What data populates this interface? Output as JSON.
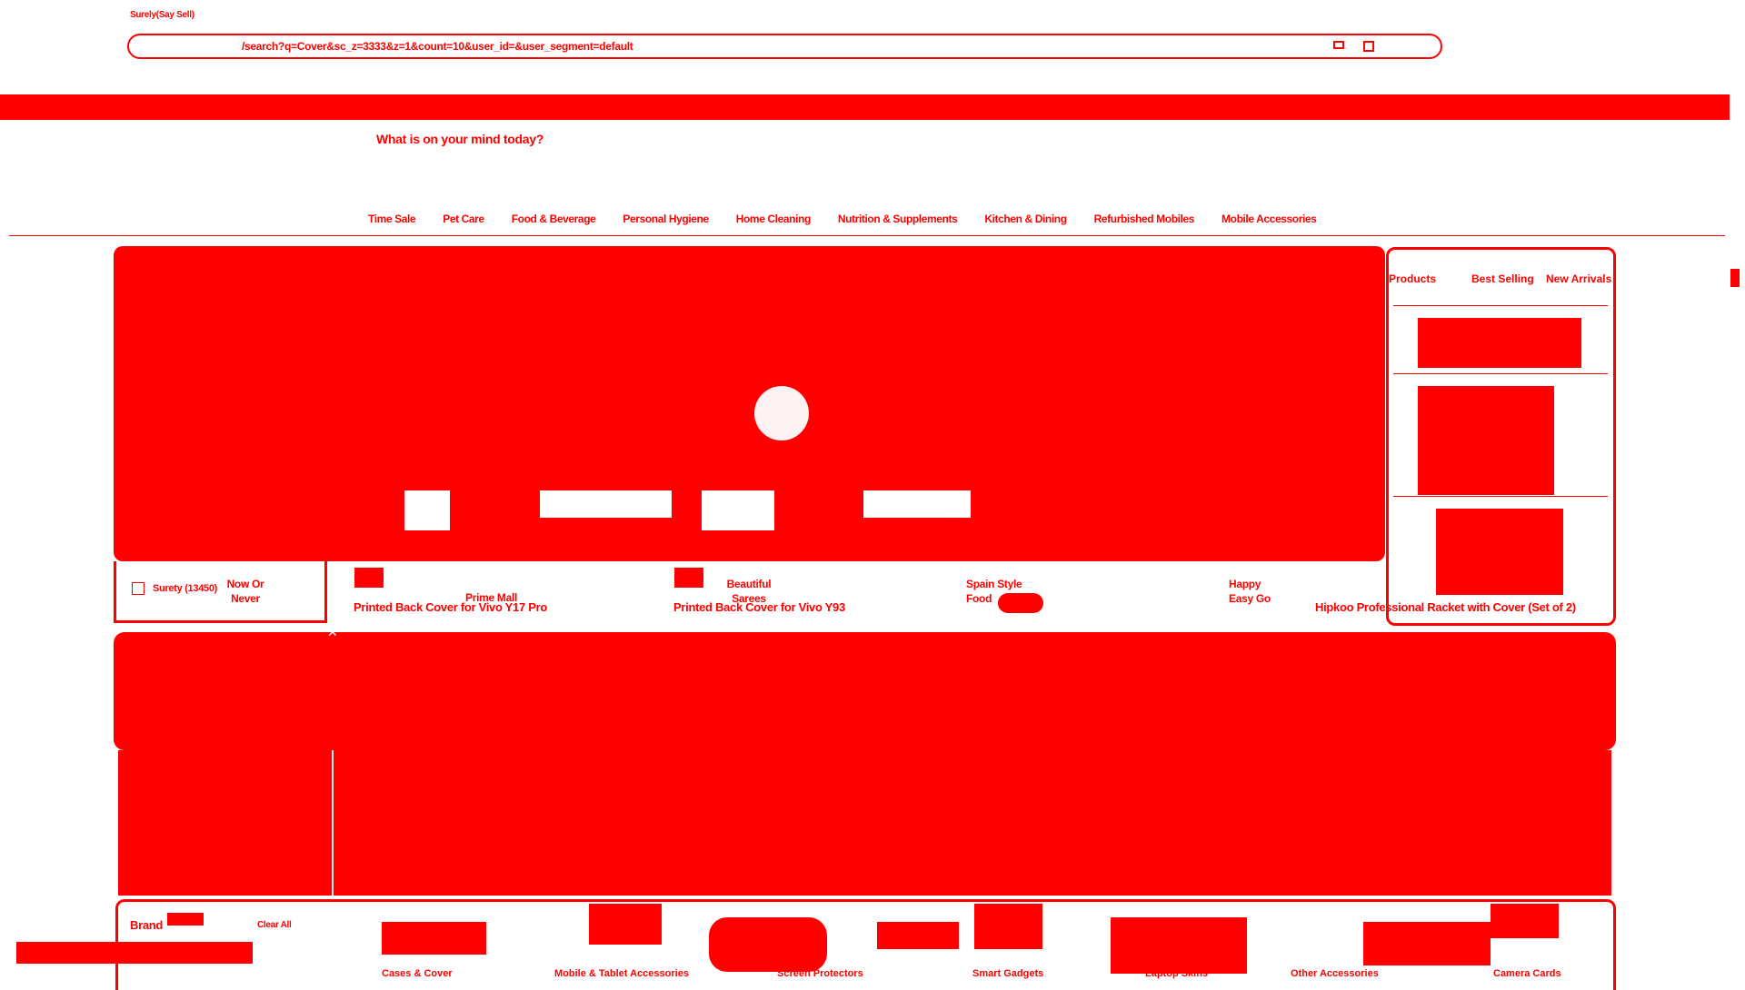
{
  "browser": {
    "tab_title": "Surely(Say Sell)",
    "url": "/search?q=Cover&sc_z=3333&z=1&count=10&user_id=&user_segment=default"
  },
  "header": {
    "search_placeholder": "What is on your mind today?"
  },
  "categories": [
    "Time Sale",
    "Pet Care",
    "Food & Beverage",
    "Personal Hygiene",
    "Home Cleaning",
    "Nutrition & Supplements",
    "Kitchen & Dining",
    "Refurbished Mobiles",
    "Mobile Accessories"
  ],
  "filters": {
    "seller_option_label": "Surety (13450)",
    "brand_label": "Brand",
    "clear_all": "Clear All"
  },
  "offers_strip": [
    {
      "label": "Now Or Never"
    },
    {
      "label": "Prime Mall"
    },
    {
      "label": "Beautiful Sarees"
    },
    {
      "label": "Spain Style Food"
    },
    {
      "label": "Happy Easy Go"
    }
  ],
  "products": [
    {
      "name": "Printed Back Cover for Vivo Y17 Pro"
    },
    {
      "name": "Printed Back Cover for Vivo Y93"
    },
    {
      "name": "Hipkoo Professional Racket with Cover (Set of 2)"
    }
  ],
  "side_panel": {
    "tabs": [
      "Products",
      "Best Selling",
      "New Arrivals"
    ]
  },
  "bottom_categories": [
    "Cases & Cover",
    "Mobile & Tablet Accessories",
    "Screen Protectors",
    "Smart Gadgets",
    "Laptop Skins",
    "Other Accessories",
    "Camera Cards"
  ],
  "colors": {
    "accent": "#ff0000",
    "background": "#ffffff"
  }
}
